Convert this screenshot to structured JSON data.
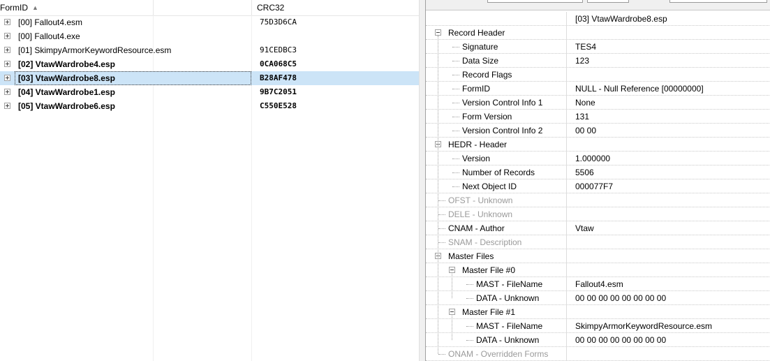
{
  "left": {
    "columns": {
      "formid": "FormID",
      "crc": "CRC32"
    },
    "rows": [
      {
        "name": "[00] Fallout4.esm",
        "crc": "75D3D6CA",
        "bold": false,
        "selected": false
      },
      {
        "name": "[00] Fallout4.exe",
        "crc": "",
        "bold": false,
        "selected": false
      },
      {
        "name": "[01] SkimpyArmorKeywordResource.esm",
        "crc": "91CEDBC3",
        "bold": false,
        "selected": false
      },
      {
        "name": "[02] VtawWardrobe4.esp",
        "crc": "0CA068C5",
        "bold": true,
        "selected": false
      },
      {
        "name": "[03] VtawWardrobe8.esp",
        "crc": "B28AF478",
        "bold": true,
        "selected": true
      },
      {
        "name": "[04] VtawWardrobe1.esp",
        "crc": "9B7C2051",
        "bold": true,
        "selected": false
      },
      {
        "name": "[05] VtawWardrobe6.esp",
        "crc": "C550E528",
        "bold": true,
        "selected": false
      }
    ]
  },
  "right": {
    "header_value": "[03] VtawWardrobe8.esp",
    "rows": [
      {
        "label": "Record Header",
        "value": "",
        "level": 0,
        "expander": true,
        "dim": false
      },
      {
        "label": "Signature",
        "value": "TES4",
        "level": 1,
        "expander": false,
        "dim": false
      },
      {
        "label": "Data Size",
        "value": "123",
        "level": 1,
        "expander": false,
        "dim": false
      },
      {
        "label": "Record Flags",
        "value": "",
        "level": 1,
        "expander": false,
        "dim": false
      },
      {
        "label": "FormID",
        "value": "NULL - Null Reference [00000000]",
        "level": 1,
        "expander": false,
        "dim": false
      },
      {
        "label": "Version Control Info 1",
        "value": "None",
        "level": 1,
        "expander": false,
        "dim": false
      },
      {
        "label": "Form Version",
        "value": "131",
        "level": 1,
        "expander": false,
        "dim": false
      },
      {
        "label": "Version Control Info 2",
        "value": "00 00",
        "level": 1,
        "expander": false,
        "dim": false
      },
      {
        "label": "HEDR - Header",
        "value": "",
        "level": 0,
        "expander": true,
        "dim": false
      },
      {
        "label": "Version",
        "value": "1.000000",
        "level": 1,
        "expander": false,
        "dim": false
      },
      {
        "label": "Number of Records",
        "value": "5506",
        "level": 1,
        "expander": false,
        "dim": false
      },
      {
        "label": "Next Object ID",
        "value": "000077F7",
        "level": 1,
        "expander": false,
        "dim": false
      },
      {
        "label": "OFST - Unknown",
        "value": "",
        "level": 0,
        "expander": false,
        "dim": true
      },
      {
        "label": "DELE - Unknown",
        "value": "",
        "level": 0,
        "expander": false,
        "dim": true
      },
      {
        "label": "CNAM - Author",
        "value": "Vtaw",
        "level": 0,
        "expander": false,
        "dim": false
      },
      {
        "label": "SNAM - Description",
        "value": "",
        "level": 0,
        "expander": false,
        "dim": true
      },
      {
        "label": "Master Files",
        "value": "",
        "level": 0,
        "expander": true,
        "dim": false
      },
      {
        "label": "Master File #0",
        "value": "",
        "level": 1,
        "expander": true,
        "dim": false
      },
      {
        "label": "MAST - FileName",
        "value": "Fallout4.esm",
        "level": 2,
        "expander": false,
        "dim": false
      },
      {
        "label": "DATA - Unknown",
        "value": "00 00 00 00 00 00 00 00",
        "level": 2,
        "expander": false,
        "dim": false
      },
      {
        "label": "Master File #1",
        "value": "",
        "level": 1,
        "expander": true,
        "dim": false
      },
      {
        "label": "MAST - FileName",
        "value": "SkimpyArmorKeywordResource.esm",
        "level": 2,
        "expander": false,
        "dim": false
      },
      {
        "label": "DATA - Unknown",
        "value": "00 00 00 00 00 00 00 00",
        "level": 2,
        "expander": false,
        "dim": false
      },
      {
        "label": "ONAM - Overridden Forms",
        "value": "",
        "level": 0,
        "expander": false,
        "dim": true
      }
    ]
  }
}
